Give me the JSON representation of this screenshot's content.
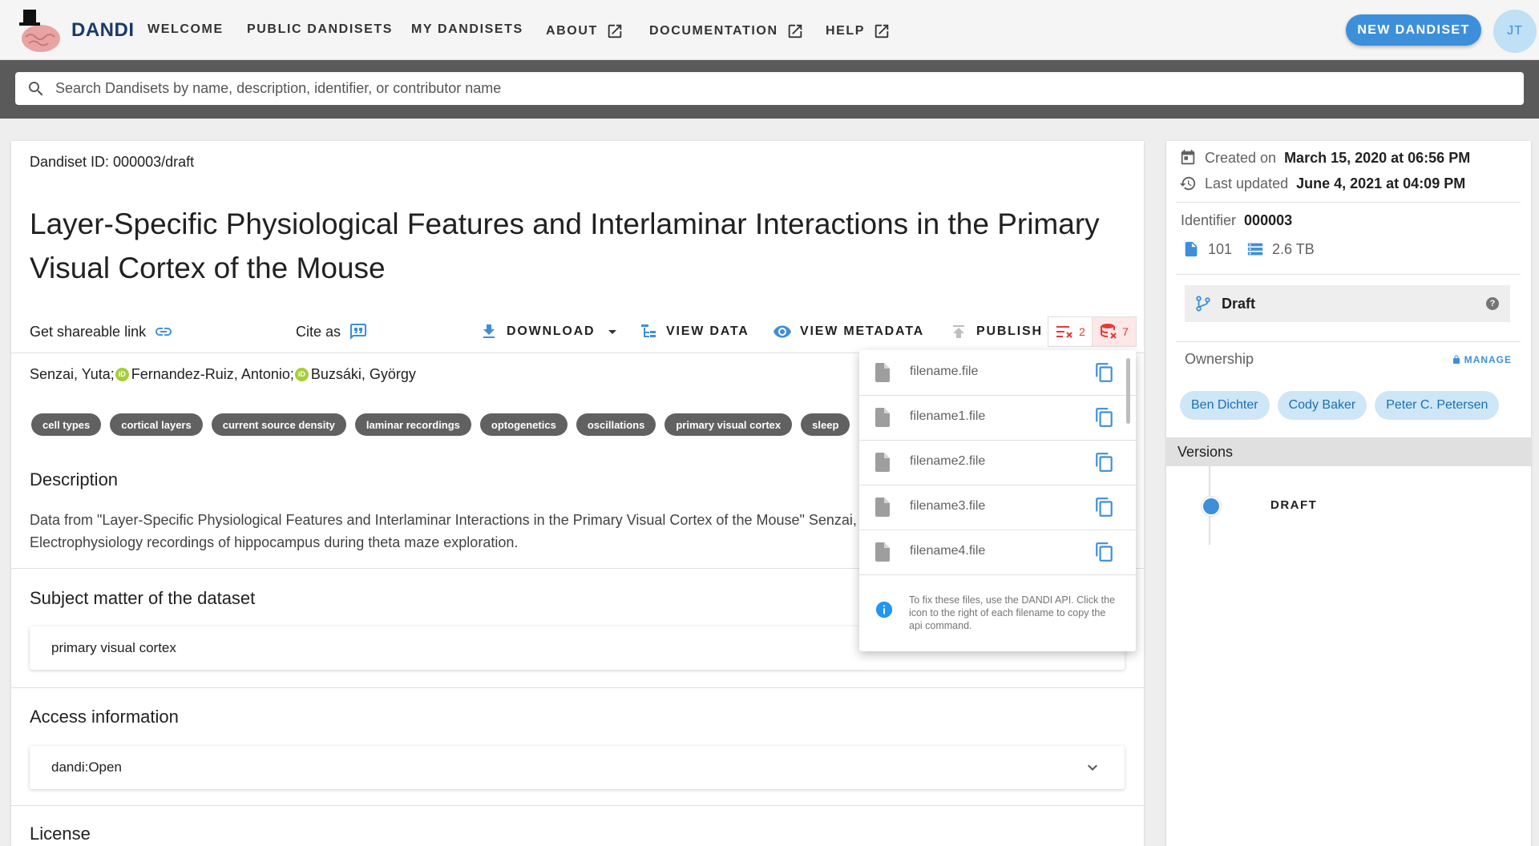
{
  "nav": {
    "brand": "DANDI",
    "items": [
      {
        "label": "WELCOME",
        "external": false
      },
      {
        "label": "PUBLIC DANDISETS",
        "external": false
      },
      {
        "label": "MY DANDISETS",
        "external": false
      },
      {
        "label": "ABOUT",
        "external": true
      },
      {
        "label": "DOCUMENTATION",
        "external": true
      },
      {
        "label": "HELP",
        "external": true
      }
    ],
    "new_button": "NEW DANDISET",
    "avatar_initials": "JT"
  },
  "search": {
    "placeholder": "Search Dandisets by name, description, identifier, or contributor name"
  },
  "dandiset": {
    "id_label": "Dandiset ID: 000003/draft",
    "title": "Layer-Specific Physiological Features and Interlaminar Interactions in the Primary Visual Cortex of the Mouse",
    "actions": {
      "share": "Get shareable link",
      "cite": "Cite as",
      "download": "DOWNLOAD",
      "view_data": "VIEW DATA",
      "view_metadata": "VIEW METADATA",
      "publish": "PUBLISH"
    },
    "errors": {
      "metadata_count": "2",
      "asset_count": "7"
    },
    "authors": [
      "Senzai, Yuta;",
      "Fernandez-Ruiz, Antonio;",
      "Buzsáki, György"
    ],
    "keywords": [
      "cell types",
      "cortical layers",
      "current source density",
      "laminar recordings",
      "optogenetics",
      "oscillations",
      "primary visual cortex",
      "sleep"
    ],
    "description_title": "Description",
    "description": "Data from \"Layer-Specific Physiological Features and Interlaminar Interactions in the Primary Visual Cortex of the Mouse\" Senzai, F",
    "description_line2": "Electrophysiology recordings of hippocampus during theta maze exploration.",
    "subject_title": "Subject matter of the dataset",
    "subject_value": "primary visual cortex",
    "access_title": "Access information",
    "access_value": "dandi:Open",
    "license_title": "License"
  },
  "dropdown": {
    "files": [
      "filename.file",
      "filename1.file",
      "filename2.file",
      "filename3.file",
      "filename4.file"
    ],
    "info": "To fix these files, use the DANDI API. Click the icon to the right of each filename to copy the api command."
  },
  "sidebar": {
    "created_label": "Created on",
    "created_value": "March 15, 2020 at 06:56 PM",
    "updated_label": "Last updated",
    "updated_value": "June 4, 2021 at 04:09 PM",
    "identifier_label": "Identifier",
    "identifier_value": "000003",
    "file_count": "101",
    "size": "2.6 TB",
    "version_label": "Draft",
    "ownership_title": "Ownership",
    "manage_label": "MANAGE",
    "owners": [
      "Ben Dichter",
      "Cody Baker",
      "Peter C. Petersen"
    ],
    "versions_title": "Versions",
    "versions": [
      "DRAFT"
    ]
  },
  "colors": {
    "accent": "#3d8fd9",
    "error": "#e53935",
    "chip_bg": "#cfe6f7",
    "keyword_bg": "#616161"
  }
}
